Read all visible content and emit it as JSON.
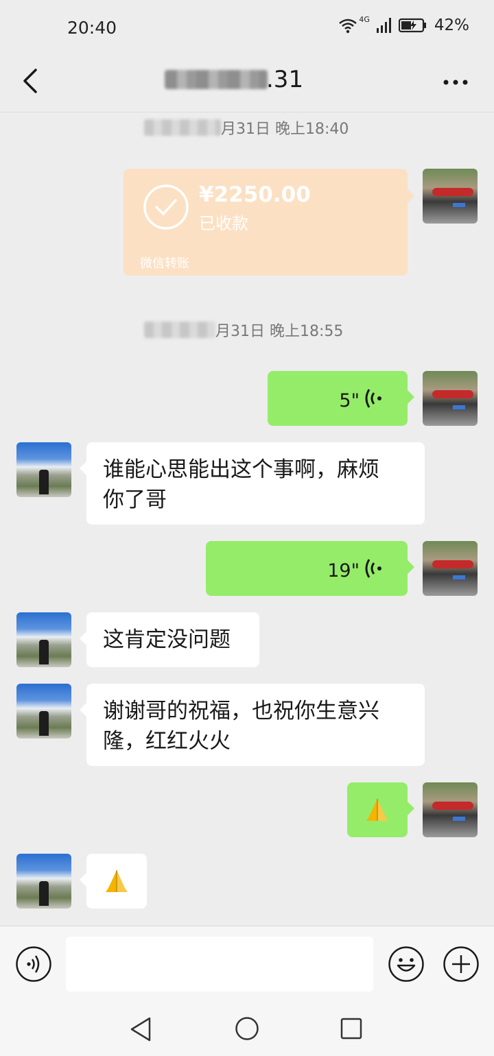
{
  "status_bar": {
    "time": "20:40",
    "network": "4G",
    "battery": "42%"
  },
  "header": {
    "title_visible": ".31"
  },
  "timestamps": [
    {
      "text": "月31日 晚上18:40"
    },
    {
      "text": "月31日 晚上18:55"
    }
  ],
  "transfer": {
    "amount": "¥2250.00",
    "status": "已收款",
    "footer": "微信转账"
  },
  "messages": [
    {
      "side": "sent",
      "type": "voice",
      "duration": "5\""
    },
    {
      "side": "received",
      "type": "text",
      "lines": [
        "谁能心思能出这个事啊，麻烦",
        "你了哥"
      ]
    },
    {
      "side": "sent",
      "type": "voice",
      "duration": "19\""
    },
    {
      "side": "received",
      "type": "text",
      "lines": [
        "这肯定没问题"
      ]
    },
    {
      "side": "received",
      "type": "text",
      "lines": [
        "谢谢哥的祝福，也祝你生意兴",
        "隆，红红火火"
      ]
    },
    {
      "side": "sent",
      "type": "emoji",
      "emoji": "folded-hands"
    },
    {
      "side": "received",
      "type": "emoji",
      "emoji": "folded-hands"
    }
  ],
  "input": {
    "placeholder": ""
  },
  "colors": {
    "background": "#ededed",
    "sent_bubble": "#95ec69",
    "received_bubble": "#ffffff",
    "transfer_card": "#fce0c3"
  }
}
